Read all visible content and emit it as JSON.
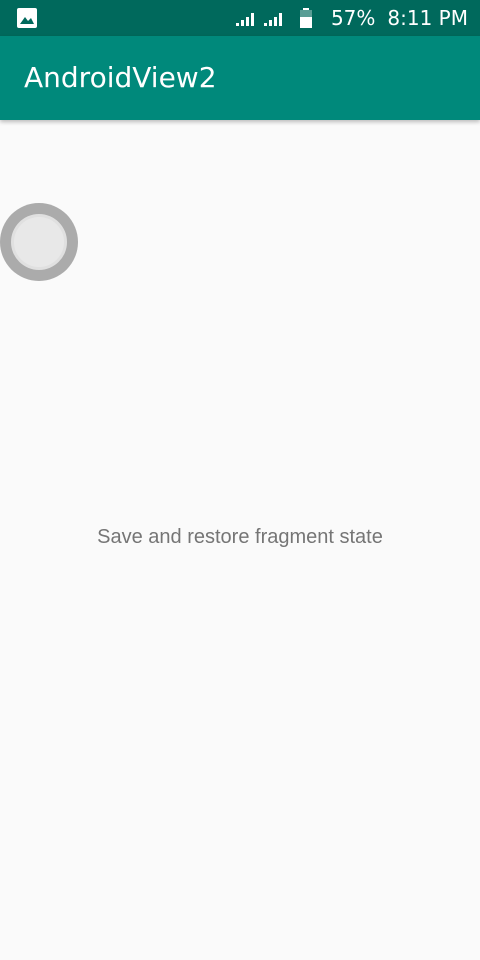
{
  "status_bar": {
    "battery_percent": "57%",
    "time": "8:11 PM",
    "left_icon": "image-icon",
    "signal_icons": [
      "signal-icon",
      "signal-icon"
    ],
    "battery_icon": "battery-icon"
  },
  "app_bar": {
    "title": "AndroidView2"
  },
  "content": {
    "message": "Save and restore fragment state",
    "floating_button_icon": "circle-button"
  },
  "colors": {
    "status_bar": "#00695c",
    "app_bar": "#00897b",
    "background": "#fafafa",
    "message_text": "#757575",
    "float_button_outer": "#ababab",
    "float_button_inner": "#e8e8e8"
  }
}
